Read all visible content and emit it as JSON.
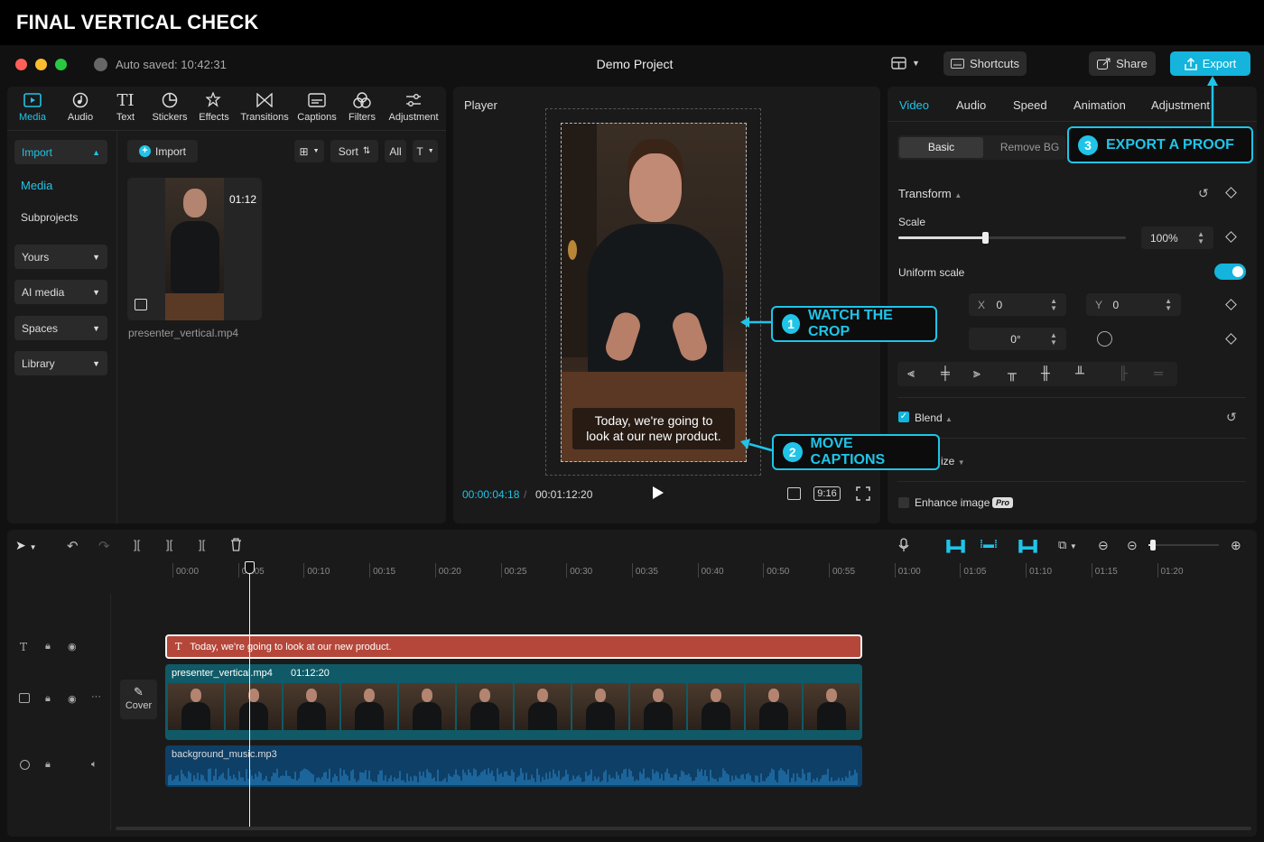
{
  "page_title": "FINAL VERTICAL CHECK",
  "window": {
    "autosave": "Auto saved: 10:42:31",
    "project_name": "Demo Project",
    "shortcuts_label": "Shortcuts",
    "share_label": "Share",
    "export_label": "Export"
  },
  "toolbar": {
    "tabs": [
      {
        "label": "Media",
        "icon": "media-icon"
      },
      {
        "label": "Audio",
        "icon": "audio-icon"
      },
      {
        "label": "Text",
        "icon": "text-icon"
      },
      {
        "label": "Stickers",
        "icon": "stickers-icon"
      },
      {
        "label": "Effects",
        "icon": "effects-icon"
      },
      {
        "label": "Transitions",
        "icon": "transitions-icon"
      },
      {
        "label": "Captions",
        "icon": "captions-icon"
      },
      {
        "label": "Filters",
        "icon": "filters-icon"
      },
      {
        "label": "Adjustment",
        "icon": "adjustment-icon"
      }
    ]
  },
  "media_sidebar": {
    "import": "Import",
    "media": "Media",
    "subprojects": "Subprojects",
    "groups": [
      "Yours",
      "AI media",
      "Spaces",
      "Library"
    ]
  },
  "media_panel": {
    "import_button": "Import",
    "sort": "Sort",
    "filter_all": "All",
    "clip_duration": "01:12",
    "clip_name": "presenter_vertical.mp4"
  },
  "player": {
    "label": "Player",
    "caption_line1": "Today, we're going to",
    "caption_line2": "look at our new product.",
    "current_time": "00:00:04:18",
    "total_time": "00:01:12:20",
    "aspect": "9:16"
  },
  "inspector": {
    "tabs": [
      "Video",
      "Audio",
      "Speed",
      "Animation",
      "Adjustment"
    ],
    "subtabs": [
      "Basic",
      "Remove BG"
    ],
    "transform": "Transform",
    "scale_label": "Scale",
    "scale_value": "100%",
    "scale_fraction": 0.38,
    "uniform_scale": "Uniform scale",
    "x_label": "X",
    "x_value": "0",
    "y_label": "Y",
    "y_value": "0",
    "rotation": "0°",
    "blend": "Blend",
    "size_partial": "ize",
    "enhance": "Enhance image",
    "pro_badge": "Pro"
  },
  "callouts": [
    {
      "num": "1",
      "text": "WATCH THE CROP"
    },
    {
      "num": "2",
      "text": "MOVE CAPTIONS"
    },
    {
      "num": "3",
      "text": "EXPORT A PROOF"
    }
  ],
  "timeline": {
    "ticks": [
      "00:00",
      "00:05",
      "00:10",
      "00:15",
      "00:20",
      "00:25",
      "00:30",
      "00:35",
      "00:40",
      "00:50",
      "00:55",
      "01:00",
      "01:05",
      "01:10",
      "01:15",
      "01:20"
    ],
    "caption_clip": "Today, we're going to look at our new product.",
    "video_clip_name": "presenter_vertical.mp4",
    "video_clip_duration": "01:12:20",
    "audio_clip_name": "background_music.mp3",
    "cover_label": "Cover"
  },
  "colors": {
    "accent": "#20c4e8",
    "caption_track": "#b5473a",
    "video_track": "#0f5a66",
    "audio_track": "#0e3f66"
  }
}
